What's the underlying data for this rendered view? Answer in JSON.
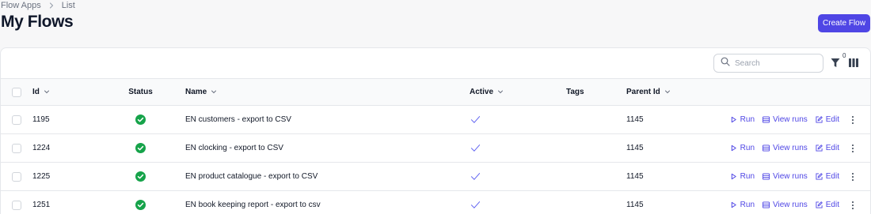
{
  "breadcrumb": {
    "items": [
      "Flow Apps",
      "List"
    ]
  },
  "page": {
    "title": "My Flows"
  },
  "toolbar": {
    "create_label": "Create Flow",
    "search_placeholder": "Search",
    "filter_count": "0"
  },
  "table": {
    "headers": {
      "id": "Id",
      "status": "Status",
      "name": "Name",
      "active": "Active",
      "tags": "Tags",
      "parent_id": "Parent Id"
    },
    "actions": {
      "run": "Run",
      "view_runs": "View runs",
      "edit": "Edit"
    },
    "rows": [
      {
        "id": "1195",
        "name": "EN customers - export to CSV",
        "parent_id": "1145",
        "tags": ""
      },
      {
        "id": "1224",
        "name": "EN clocking - export to CSV",
        "parent_id": "1145",
        "tags": ""
      },
      {
        "id": "1225",
        "name": "EN product catalogue - export to CSV",
        "parent_id": "1145",
        "tags": ""
      },
      {
        "id": "1251",
        "name": "EN book keeping report - export to csv",
        "parent_id": "1145",
        "tags": ""
      }
    ]
  },
  "colors": {
    "accent": "#4f46e5",
    "status_ok": "#16a34a",
    "active_check": "#6366f1"
  }
}
